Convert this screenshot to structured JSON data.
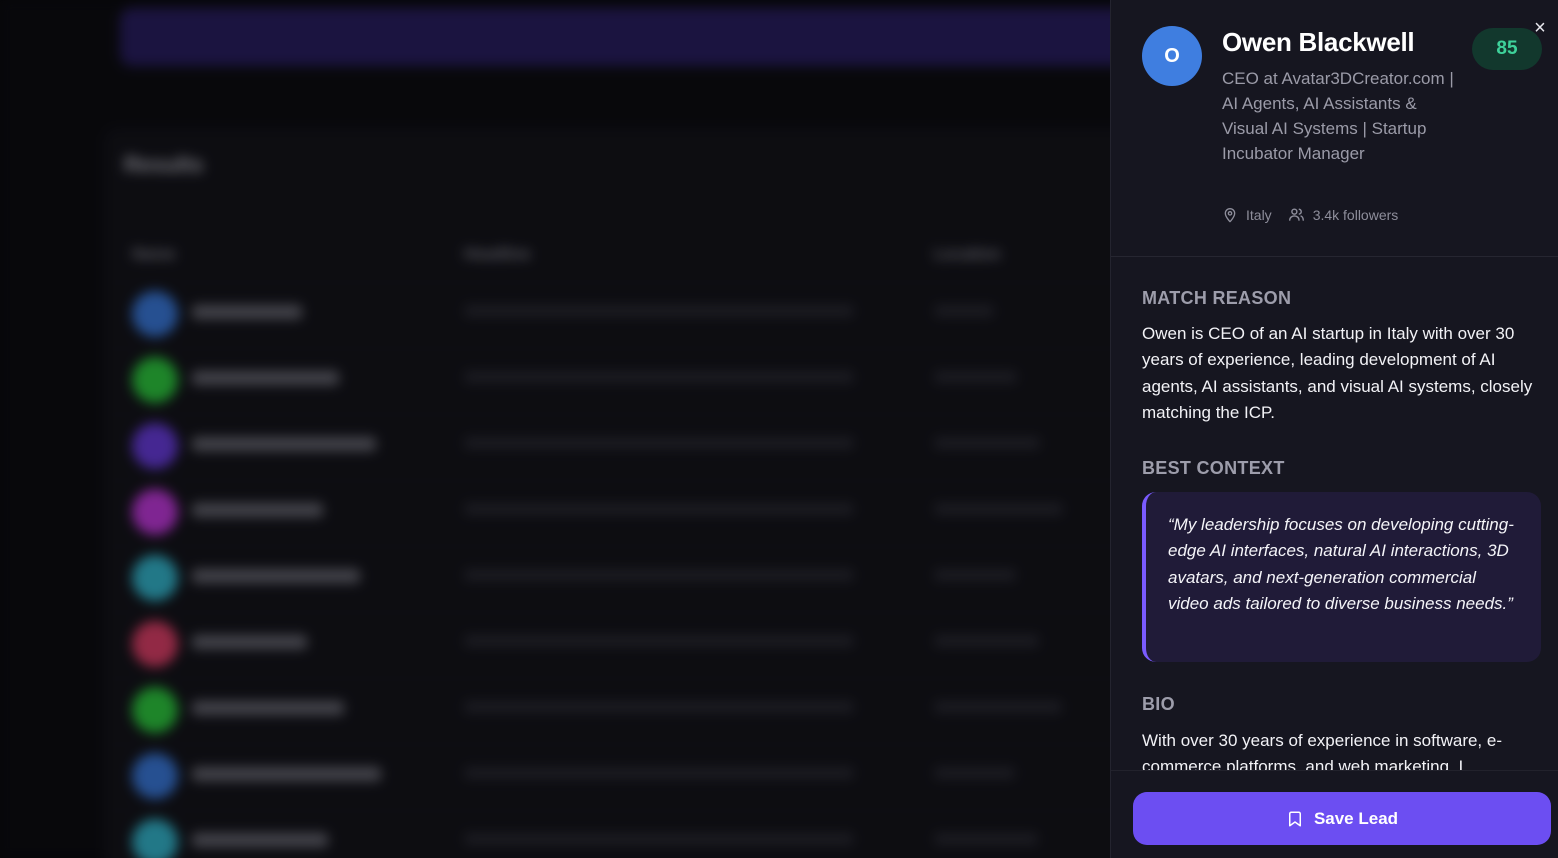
{
  "background": {
    "search_label": "",
    "results_title": "Results",
    "results_subtitle": "",
    "columns": [
      "Name",
      "Headline",
      "Location"
    ],
    "avatar_colors": [
      "#3b7bdf",
      "#2ecc40",
      "#6a3de0",
      "#c43ae0",
      "#35b8d0",
      "#e0406a",
      "#2ecc40",
      "#3b7bdf",
      "#35b8d0"
    ]
  },
  "profile": {
    "initial": "O",
    "avatar_color": "#3f7ee0",
    "name": "Owen Blackwell",
    "headline": "CEO at Avatar3DCreator.com | AI Agents, AI Assistants & Visual AI Systems | Startup Incubator Manager",
    "score": "85",
    "location": "Italy",
    "followers": "3.4k followers"
  },
  "sections": {
    "match_reason_title": "MATCH REASON",
    "match_reason_text": "Owen is CEO of an AI startup in Italy with over 30 years of experience, leading development of AI agents, AI assistants, and visual AI systems, closely matching the ICP.",
    "best_context_title": "BEST CONTEXT",
    "best_context_quote": "“My leadership focuses on developing cutting-edge AI interfaces, natural AI interactions, 3D avatars, and next-generation commercial video ads tailored to diverse business needs.”",
    "bio_title": "BIO",
    "bio_text": "With over 30 years of experience in software, e-commerce platforms, and web marketing, I"
  },
  "actions": {
    "close_label": "×",
    "save_label": "Save Lead"
  },
  "icons": {
    "close": "close-icon",
    "location": "map-pin-icon",
    "followers": "users-icon",
    "save": "bookmark-icon"
  },
  "colors": {
    "accent": "#6c4ef2",
    "score_bg": "#12382d",
    "score_text": "#3ed29a",
    "panel_bg": "#161620"
  }
}
